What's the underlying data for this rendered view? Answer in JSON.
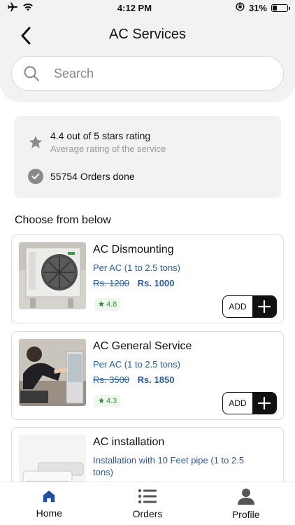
{
  "status_bar": {
    "time": "4:12 PM",
    "battery_text": "31%",
    "battery_level": 0.31
  },
  "header": {
    "title": "AC Services"
  },
  "search": {
    "placeholder": "Search"
  },
  "rating": {
    "title": "4.4 out of 5 stars rating",
    "subtitle": "Average rating of the service",
    "orders": "55754 Orders done"
  },
  "section_title": "Choose from below",
  "services": [
    {
      "name": "AC Dismounting",
      "desc": "Per AC (1 to 2.5 tons)",
      "old_price": "Rs. 1200",
      "new_price": "Rs. 1000",
      "rating": "4.8",
      "add_label": "ADD"
    },
    {
      "name": "AC General Service",
      "desc": "Per AC (1 to 2.5 tons)",
      "old_price": "Rs. 3500",
      "new_price": "Rs. 1850",
      "rating": "4.3",
      "add_label": "ADD"
    },
    {
      "name": "AC installation",
      "desc": "Installation with 10 Feet pipe (1 to 2.5 tons)"
    }
  ],
  "nav": {
    "home": "Home",
    "orders": "Orders",
    "profile": "Profile"
  },
  "colors": {
    "accent": "#2a5aa6",
    "active_nav": "#1d4fa3",
    "rating_green": "#2e9a3c"
  }
}
